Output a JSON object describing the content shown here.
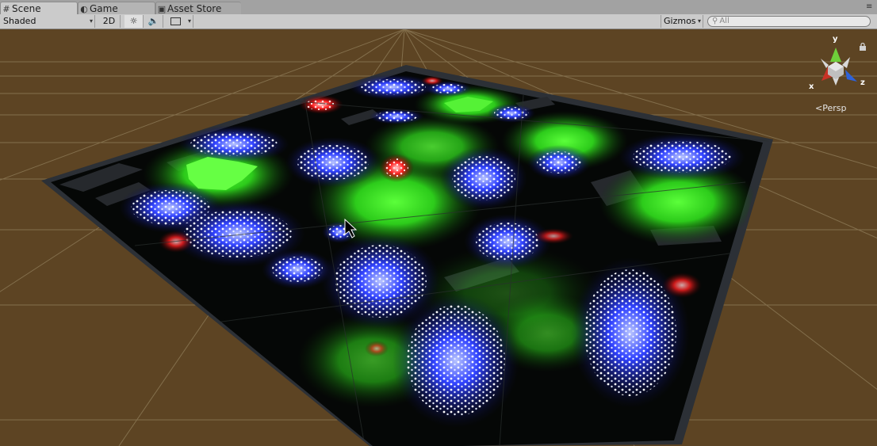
{
  "tabs": [
    {
      "label": "Scene",
      "icon": "grid-icon"
    },
    {
      "label": "Game",
      "icon": "pacman-icon"
    },
    {
      "label": "Asset Store",
      "icon": "store-icon"
    }
  ],
  "toolbar": {
    "draw_mode": "Shaded",
    "mode_2d": "2D",
    "gizmos_label": "Gizmos",
    "search_placeholder": "All"
  },
  "gizmo": {
    "axis_y": "y",
    "axis_x": "x",
    "axis_z": "z",
    "projection": "Persp"
  },
  "colors": {
    "ground": "#5c4322",
    "grid": "#8c7a5a",
    "blue_unit": "#2a3cff",
    "green_light": "#3cff2a",
    "red_unit": "#ff2a2a"
  }
}
